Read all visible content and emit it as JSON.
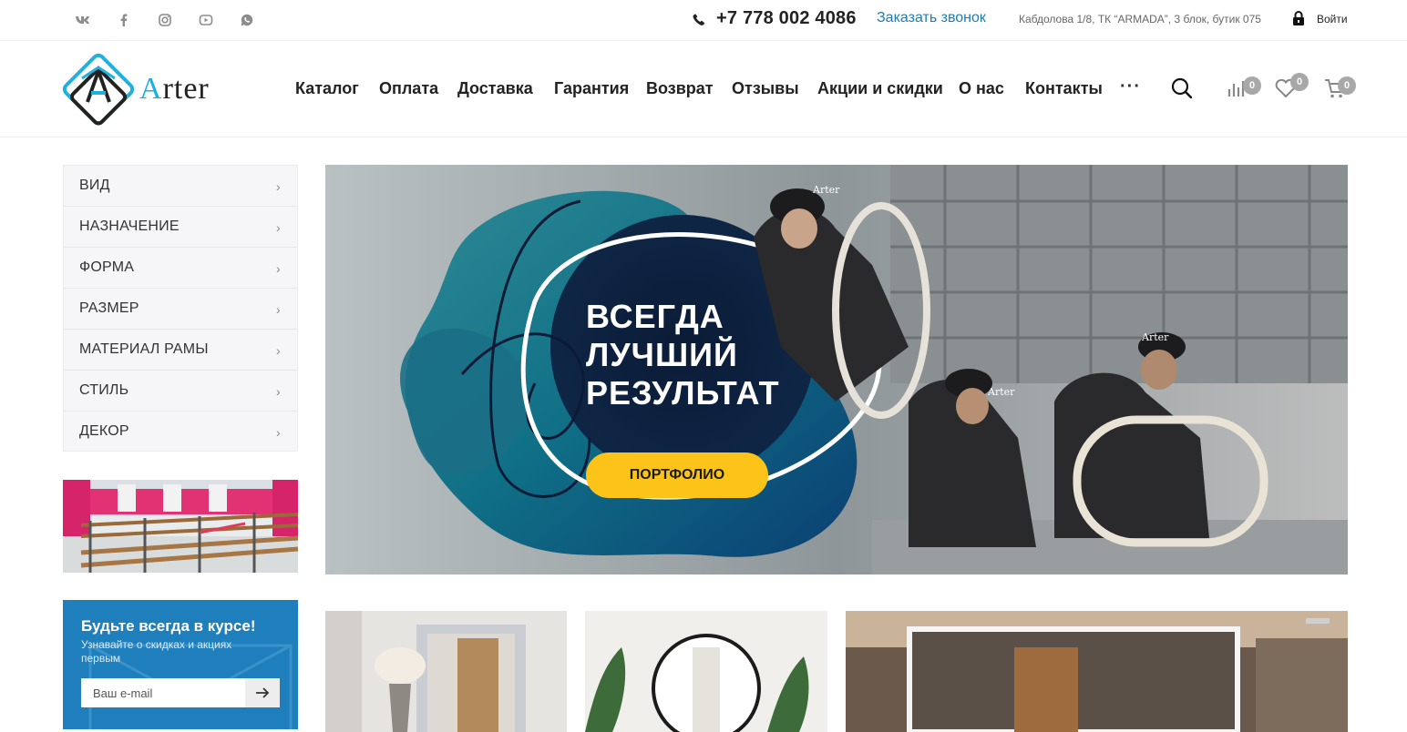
{
  "topbar": {
    "social_icons": [
      "vk-icon",
      "facebook-icon",
      "instagram-icon",
      "youtube-icon",
      "whatsapp-icon"
    ],
    "phone": "+7 778 002 4086",
    "callback": "Заказать звонок",
    "address": "Кабдолова 1/8, ТК “ARMADA”, 3 блок, бутик 075",
    "login": "Войти"
  },
  "header": {
    "logo_text_a": "A",
    "logo_text_rest": "rter",
    "nav": [
      "Каталог",
      "Оплата",
      "Доставка",
      "Гарантия",
      "Возврат",
      "Отзывы",
      "Акции и скидки",
      "О нас",
      "Контакты"
    ],
    "more": "···",
    "compare_count": "0",
    "favorites_count": "0",
    "cart_count": "0"
  },
  "sidebar": {
    "categories": [
      "ВИД",
      "НАЗНАЧЕНИЕ",
      "ФОРМА",
      "РАЗМЕР",
      "МАТЕРИАЛ РАМЫ",
      "СТИЛЬ",
      "ДЕКОР"
    ],
    "chevron": "›"
  },
  "subscribe": {
    "title": "Будьте всегда в курсе!",
    "text": "Узнавайте о скидках и акциях первым",
    "placeholder": "Ваш e-mail"
  },
  "hero": {
    "title_lines": [
      "ВСЕГДА",
      "ЛУЧШИЙ",
      "РЕЗУЛЬТАТ"
    ],
    "button": "ПОРТФОЛИО",
    "cap_text": "Arter"
  },
  "colors": {
    "accent_blue": "#1a7db8",
    "subscribe_bg": "#1f7fbc",
    "button_yellow": "#fcc419",
    "logo_cyan": "#1fb0e0"
  }
}
